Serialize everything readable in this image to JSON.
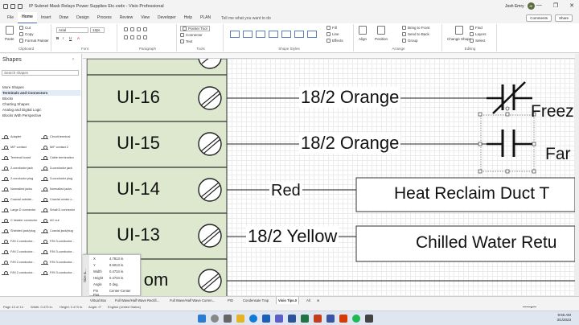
{
  "window": {
    "title": "IP Subnet Mask Relays Power Supplies Etc.vsdx  -  Visio Professional",
    "user_name": "Josh Emry",
    "user_initials": "JE",
    "minimize": "—",
    "restore": "❐",
    "close": "✕"
  },
  "tabs": [
    "File",
    "Home",
    "Insert",
    "Draw",
    "Design",
    "Process",
    "Review",
    "View",
    "Developer",
    "Help",
    "PLAN"
  ],
  "tell_me": "Tell me what you want to do",
  "header_buttons": {
    "comments": "Comments",
    "share": "Share"
  },
  "ribbon": {
    "clipboard": {
      "paste": "Paste",
      "cut": "Cut",
      "copy": "Copy",
      "format_painter": "Format Painter",
      "label": "Clipboard"
    },
    "font": {
      "family": "Arial",
      "size": "12pt.",
      "label": "Font"
    },
    "paragraph": {
      "label": "Paragraph"
    },
    "tools": {
      "pointer": "Pointer Tool",
      "connector": "Connector",
      "text": "Text",
      "label": "Tools"
    },
    "shape_styles": {
      "fill": "Fill",
      "line": "Line",
      "effects": "Effects",
      "label": "Shape Styles"
    },
    "arrange": {
      "align": "Align",
      "position": "Position",
      "bring_front": "Bring to Front",
      "send_back": "Send to Back",
      "group": "Group",
      "label": "Arrange"
    },
    "editing": {
      "change_shape": "Change Shape",
      "find": "Find",
      "layers": "Layers",
      "select": "Select",
      "label": "Editing"
    }
  },
  "shapes_panel": {
    "title": "Shapes",
    "search_placeholder": "Search shapes",
    "stencils": [
      "More Shapes",
      "Terminals and Connectors",
      "Blocks",
      "Charting Shapes",
      "Analog and Digital Logic",
      "Blocks With Perspective"
    ],
    "items": [
      "Adapter",
      "Circuit terminal",
      "M/F contact",
      "M/F contact 2",
      "Terminal board",
      "Cable termination",
      "2-conductor jack",
      "3-conductor jack",
      "2-conductor plug",
      "3-conductor plug",
      "Normalled jacks",
      "Normalled jacks",
      "Coaxial outside...",
      "Coaxial center c...",
      "Large D connector",
      "Small D connector",
      "C header connector",
      "AC out",
      "Shielded jack/plug",
      "Coaxial jack/plug",
      "F/M 2-conductor...",
      "F/M 3-conductor...",
      "F/M 2-conductor...",
      "F/M 3-conductor...",
      "F/M 2-conductor...",
      "F/M 3-conductor...",
      "F/M 2-conductor...",
      "F/M 3-conductor..."
    ]
  },
  "drawing": {
    "terminals": [
      "UI-16",
      "UI-15",
      "UI-14",
      "UI-13",
      "om"
    ],
    "wires": [
      "18/2 Orange",
      "18/2 Orange",
      "Red",
      "18/2 Yellow"
    ],
    "boxes": [
      "Heat Reclaim Duct T",
      "Chilled Water Retu"
    ],
    "labels": [
      "Freez",
      "Far"
    ]
  },
  "size_position": {
    "title": "Size &...",
    "rows": [
      {
        "k": "X",
        "v": "4.7813 in."
      },
      {
        "k": "Y",
        "v": "9.5013 in."
      },
      {
        "k": "Width",
        "v": "0.4734 in."
      },
      {
        "k": "Height",
        "v": "0.4734 in."
      },
      {
        "k": "Angle",
        "v": "0 deg."
      },
      {
        "k": "Pin Pos",
        "v": "Center-Center"
      }
    ]
  },
  "page_tabs": [
    "Virtual Box",
    "Full Wave/Half Wave Rectifi...",
    "Full Wave/Half Wave Curren...",
    "PID",
    "Condensate Trap",
    "Visio Tips.0",
    "All"
  ],
  "status": {
    "page": "Page 13 of 14",
    "width": "Width: 0.473 in.",
    "height": "Height: 0.473 in.",
    "angle": "Angle: 0°",
    "language": "English (United States)"
  },
  "clock": {
    "time": "9:55 AM",
    "date": "3/1/2023"
  }
}
